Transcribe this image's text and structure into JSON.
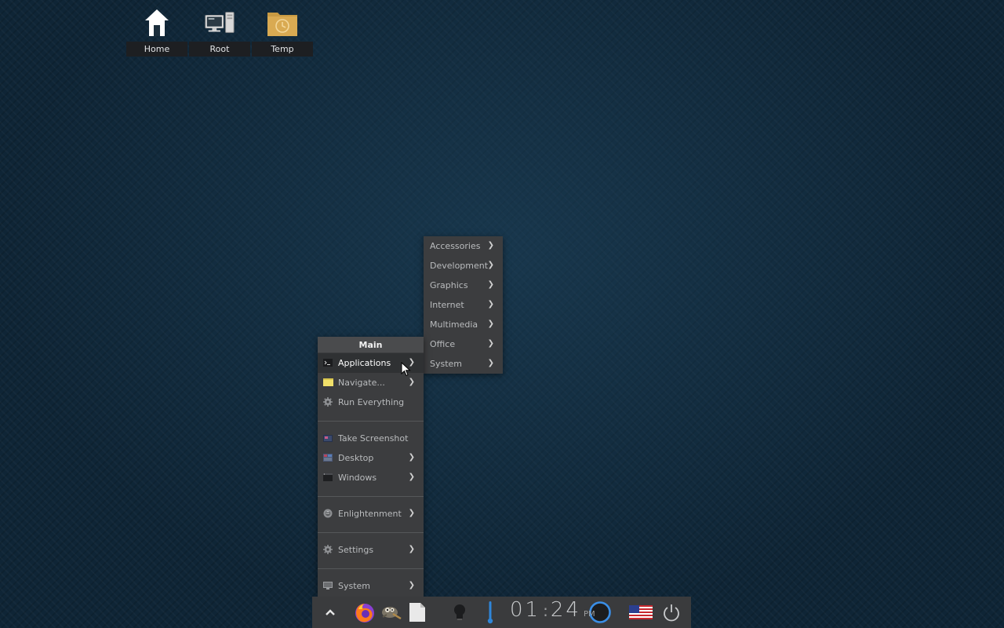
{
  "desktop": {
    "icons": [
      {
        "label": "Home",
        "icon": "home-icon"
      },
      {
        "label": "Root",
        "icon": "computer-icon"
      },
      {
        "label": "Temp",
        "icon": "folder-clock-icon"
      }
    ]
  },
  "main_menu": {
    "title": "Main",
    "items": [
      {
        "label": "Applications",
        "icon": "terminal-icon",
        "submenu": true,
        "active": true
      },
      {
        "label": "Navigate...",
        "icon": "folder-icon",
        "submenu": true
      },
      {
        "label": "Run Everything",
        "icon": "gear-icon",
        "submenu": false
      },
      {
        "label": "Take Screenshot",
        "icon": "screenshot-icon",
        "submenu": false
      },
      {
        "label": "Desktop",
        "icon": "desktop-icon",
        "submenu": true
      },
      {
        "label": "Windows",
        "icon": "windows-icon",
        "submenu": true
      },
      {
        "label": "Enlightenment",
        "icon": "enlightenment-icon",
        "submenu": true
      },
      {
        "label": "Settings",
        "icon": "gear-icon",
        "submenu": true
      },
      {
        "label": "System",
        "icon": "monitor-icon",
        "submenu": true
      }
    ]
  },
  "applications_menu": {
    "items": [
      {
        "label": "Accessories"
      },
      {
        "label": "Development"
      },
      {
        "label": "Graphics"
      },
      {
        "label": "Internet"
      },
      {
        "label": "Multimedia"
      },
      {
        "label": "Office"
      },
      {
        "label": "System"
      }
    ]
  },
  "taskbar": {
    "clock": {
      "hours": "01",
      "minutes": "24",
      "ampm": "PM"
    },
    "items": [
      "expand-up-icon",
      "firefox-icon",
      "gimp-icon",
      "document-icon",
      "lightbulb-icon",
      "thermometer-icon",
      "circle-indicator-icon",
      "us-flag-icon",
      "power-icon"
    ]
  },
  "colors": {
    "menu_bg": "#3c3d3f",
    "active_item": "#2f3133",
    "accent_blue": "#3a8ee6",
    "desktop_bg": "#0f2536"
  }
}
